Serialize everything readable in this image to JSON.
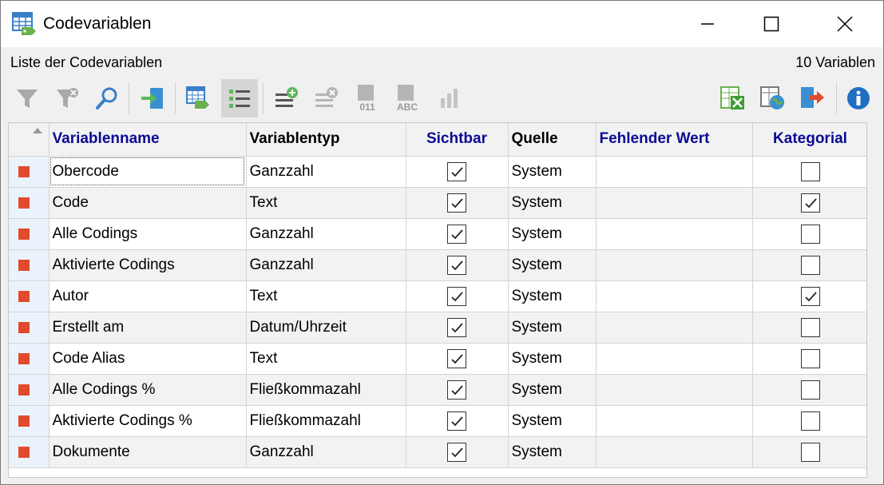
{
  "window": {
    "title": "Codevariablen",
    "minimize_glyph": "—",
    "maximize_glyph": "□",
    "close_glyph": "✕"
  },
  "header": {
    "list_label": "Liste der Codevariablen",
    "count_label": "10 Variablen"
  },
  "toolbar": {
    "icons": [
      "filter-icon",
      "clear-filter-icon",
      "search-icon",
      "import-icon",
      "table-icon",
      "list-view-icon",
      "add-variable-icon",
      "delete-variable-icon",
      "numeric-variable-icon",
      "text-variable-icon",
      "statistics-icon",
      "excel-export-icon",
      "web-export-icon",
      "export-icon",
      "info-icon"
    ],
    "label_011": "011",
    "label_abc": "ABC"
  },
  "table": {
    "headers": [
      "Variablenname",
      "Variablentyp",
      "Sichtbar",
      "Quelle",
      "Fehlender Wert",
      "Kategorial"
    ],
    "rows": [
      {
        "name": "Obercode",
        "type": "Ganzzahl",
        "visible": true,
        "source": "System",
        "missing": "",
        "categorical": false
      },
      {
        "name": "Code",
        "type": "Text",
        "visible": true,
        "source": "System",
        "missing": "",
        "categorical": true
      },
      {
        "name": "Alle Codings",
        "type": "Ganzzahl",
        "visible": true,
        "source": "System",
        "missing": "",
        "categorical": false
      },
      {
        "name": "Aktivierte Codings",
        "type": "Ganzzahl",
        "visible": true,
        "source": "System",
        "missing": "",
        "categorical": false
      },
      {
        "name": "Autor",
        "type": "Text",
        "visible": true,
        "source": "System",
        "missing": "",
        "categorical": true
      },
      {
        "name": "Erstellt am",
        "type": "Datum/Uhrzeit",
        "visible": true,
        "source": "System",
        "missing": "",
        "categorical": false
      },
      {
        "name": "Code Alias",
        "type": "Text",
        "visible": true,
        "source": "System",
        "missing": "",
        "categorical": false
      },
      {
        "name": "Alle Codings %",
        "type": "Fließkommazahl",
        "visible": true,
        "source": "System",
        "missing": "",
        "categorical": false
      },
      {
        "name": "Aktivierte Codings %",
        "type": "Fließkommazahl",
        "visible": true,
        "source": "System",
        "missing": "",
        "categorical": false
      },
      {
        "name": "Dokumente",
        "type": "Ganzzahl",
        "visible": true,
        "source": "System",
        "missing": "",
        "categorical": false
      }
    ]
  },
  "colors": {
    "header_blue": "#0a0a96",
    "row_marker": "#e24a2e"
  }
}
